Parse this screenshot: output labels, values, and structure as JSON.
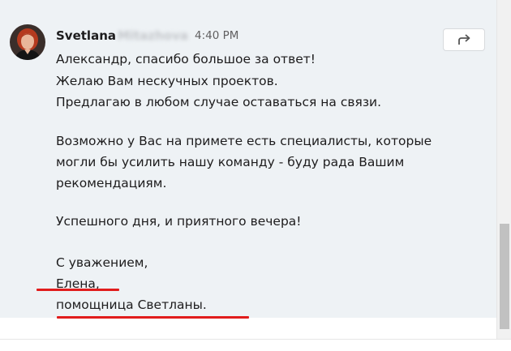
{
  "message": {
    "sender_name": "Svetlana",
    "sender_surname_blurred": "Mitazhova",
    "timestamp": "4:40 PM",
    "share_icon": "share-forward-icon",
    "avatar_icon": "user-avatar-photo",
    "lines": [
      "Александр, спасибо большое за ответ!",
      "Желаю Вам нескучных проектов.",
      "Предлагаю в любом случае оставаться на связи.",
      "Возможно у Вас на примете есть специалисты, которые",
      "могли бы усилить нашу команду - буду рада Вашим",
      "рекомендациям.",
      "Успешного дня, и приятного вечера!",
      "С уважением,",
      "Елена,",
      "помощница Светланы."
    ]
  },
  "colors": {
    "message_bg": "#eef2f5",
    "annotation_underline": "#e11c1c",
    "timestamp": "#616061"
  }
}
